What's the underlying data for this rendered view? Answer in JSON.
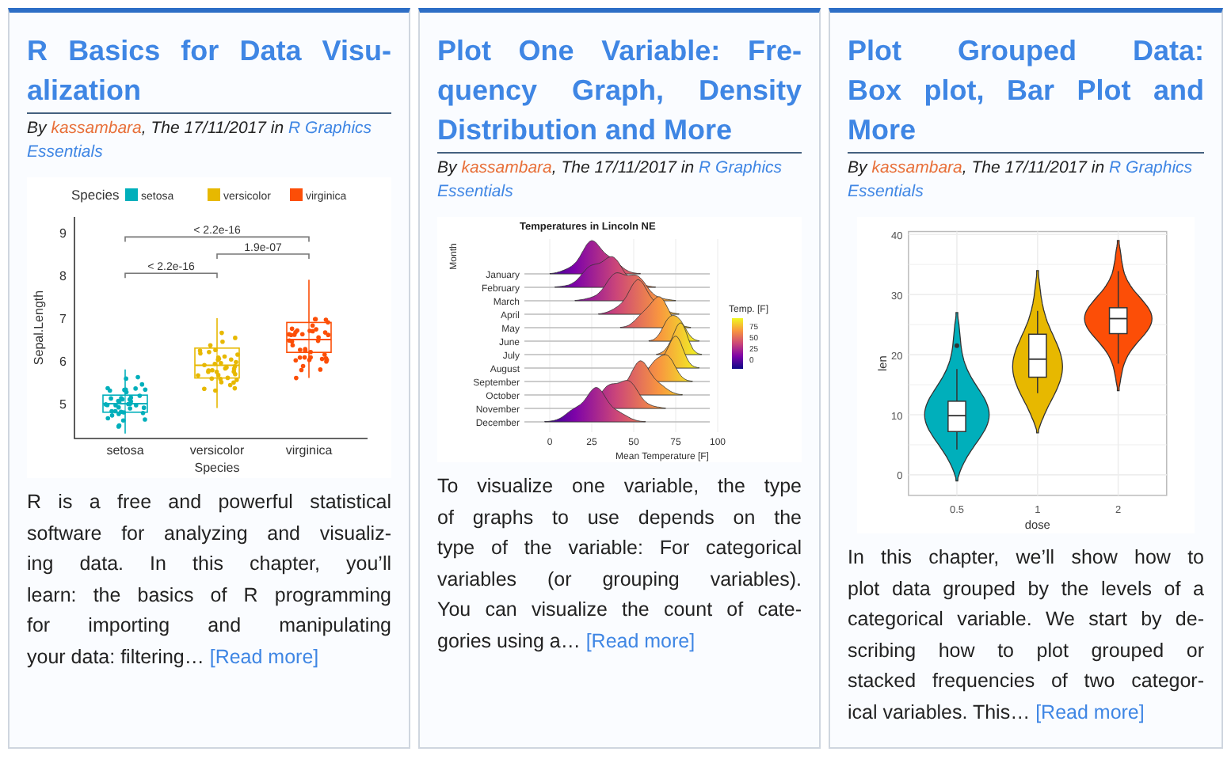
{
  "cards": [
    {
      "title_lines": [
        "R Basics for Data Visu-",
        "alization"
      ],
      "byline": {
        "prefix": "By",
        "author": "kassambara",
        "middle": ", The 17/11/2017 in",
        "category_lines": [
          "R Graphics",
          "Essentials"
        ]
      },
      "figure": {
        "kind": "box_jitter",
        "legend_title": "Species",
        "legend": [
          {
            "label": "setosa",
            "color": "#00afbb"
          },
          {
            "label": "versicolor",
            "color": "#e7b800"
          },
          {
            "label": "virginica",
            "color": "#fc4e07"
          }
        ],
        "comparisons": [
          "< 2.2e-16",
          "1.9e-07",
          "< 2.2e-16"
        ],
        "y_title": "Sepal.Length",
        "yticks": [
          "9",
          "8",
          "7",
          "6",
          "5"
        ],
        "x_labels": [
          "setosa",
          "versicolor",
          "virginica"
        ],
        "x_title": "Species"
      },
      "excerpt": {
        "lines": [
          "R is a free and powerful statistical",
          "software for analyzing and visualiz-",
          "ing data. In this chapter, you’ll",
          "learn: the basics of R programming",
          "for importing and manipulating",
          "your data: filtering…"
        ],
        "link": "[Read more]"
      }
    },
    {
      "title_lines": [
        "Plot One Variable: Fre-",
        "quency Graph, Density",
        "Distribution and More"
      ],
      "byline": {
        "prefix": "By",
        "author": "kassambara",
        "middle": ", The 17/11/2017 in",
        "category_lines": [
          "R Graphics",
          "Essentials"
        ]
      },
      "figure": {
        "kind": "ridgeline",
        "title": "Temperatures in Lincoln NE",
        "y_title": "Month",
        "months": [
          "January",
          "February",
          "March",
          "April",
          "May",
          "June",
          "July",
          "August",
          "September",
          "October",
          "November",
          "December"
        ],
        "xticks": [
          "0",
          "25",
          "50",
          "75",
          "100"
        ],
        "x_title": "Mean Temperature [F]",
        "legend_title": "Temp. [F]",
        "legend_ticks": [
          "75",
          "50",
          "25",
          "0"
        ]
      },
      "excerpt": {
        "lines": [
          "To visualize one variable, the type",
          "of graphs to use depends on the",
          "type of the variable: For categorical",
          "variables (or grouping variables).",
          "You can visualize the count of cate-",
          "gories using a…"
        ],
        "link": "[Read more]"
      }
    },
    {
      "title_lines": [
        "Plot Grouped Data:",
        "Box plot, Bar Plot and",
        "More"
      ],
      "byline": {
        "prefix": "By",
        "author": "kassambara",
        "middle": ", The 17/11/2017 in",
        "category_lines": [
          "R Graphics",
          "Essentials"
        ]
      },
      "figure": {
        "kind": "violin",
        "yticks": [
          "40",
          "30",
          "20",
          "10",
          "0"
        ],
        "y_title": "len",
        "groups": [
          {
            "label": "0.5",
            "color": "#00afbb"
          },
          {
            "label": "1",
            "color": "#e7b800"
          },
          {
            "label": "2",
            "color": "#fc4e07"
          }
        ],
        "x_title": "dose"
      },
      "excerpt": {
        "lines": [
          "In this chapter, we’ll show how to",
          "plot data grouped by the levels of a",
          "categorical variable. We start by de-",
          "scribing how to plot grouped or",
          "stacked frequencies of two categor-",
          "ical variables. This…"
        ],
        "link": "[Read more]"
      }
    }
  ]
}
